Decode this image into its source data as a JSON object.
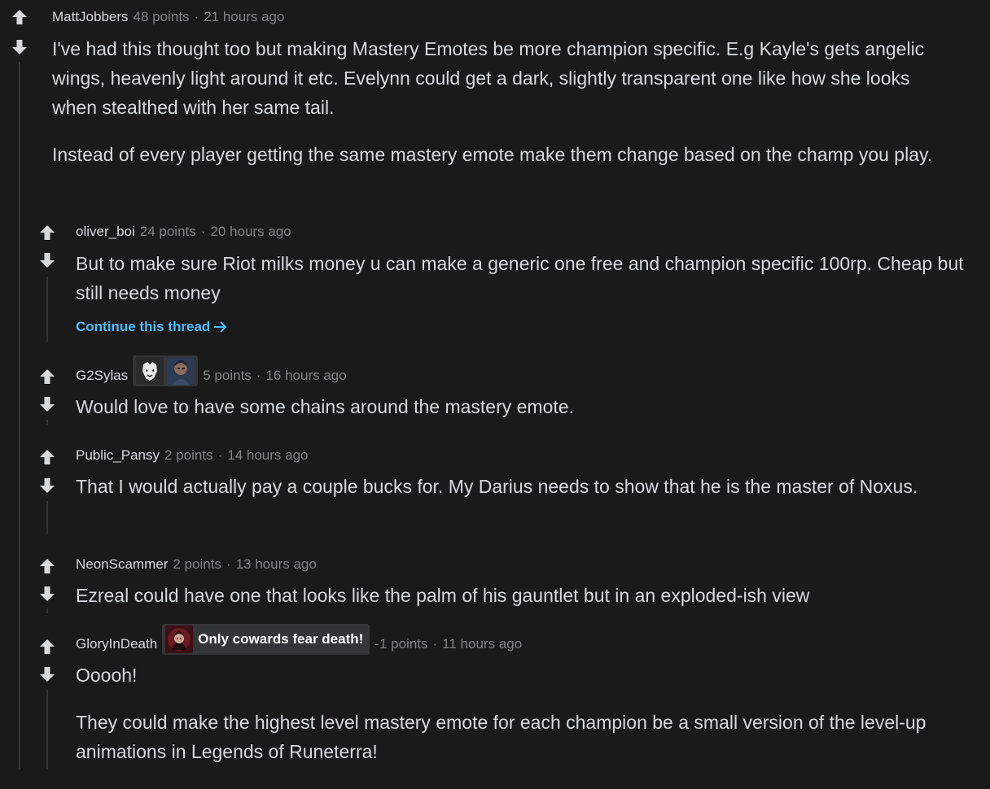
{
  "colors": {
    "background": "#1a1a1b",
    "text": "#d7dadc",
    "meta": "#818384",
    "arrow": "#d7dadc",
    "thread_line": "#343536",
    "link": "#4fbcff"
  },
  "icons": {
    "upvote": "arrow-up-icon",
    "downvote": "arrow-down-icon",
    "continue": "arrow-right-icon"
  },
  "comments": [
    {
      "author": "MattJobbers",
      "points": "48 points",
      "separator": "·",
      "time": "21 hours ago",
      "paragraphs": [
        "I've had this thought too but making Mastery Emotes be more champion specific. E.g Kayle's gets angelic wings, heavenly light around it etc. Evelynn could get a dark, slightly transparent one like how she looks when stealthed with her same tail.",
        "Instead of every player getting the same mastery emote make them change based on the champ you play."
      ]
    },
    {
      "author": "oliver_boi",
      "points": "24 points",
      "separator": "·",
      "time": "20 hours ago",
      "paragraphs": [
        "But to make sure Riot milks money u can make a generic one free and champion specific 100rp. Cheap but still needs money"
      ],
      "continue_label": "Continue this thread"
    },
    {
      "author": "G2Sylas",
      "flair_icons": [
        "g2-logo-icon",
        "sylas-portrait-icon"
      ],
      "points": "5 points",
      "separator": "·",
      "time": "16 hours ago",
      "paragraphs": [
        "Would love to have some chains around the mastery emote."
      ]
    },
    {
      "author": "Public_Pansy",
      "points": "2 points",
      "separator": "·",
      "time": "14 hours ago",
      "paragraphs": [
        "That I would actually pay a couple bucks for. My Darius needs to show that he is the master of Noxus."
      ]
    },
    {
      "author": "NeonScammer",
      "points": "2 points",
      "separator": "·",
      "time": "13 hours ago",
      "paragraphs": [
        "Ezreal could have one that looks like the palm of his gauntlet but in an exploded-ish view"
      ]
    },
    {
      "author": "GloryInDeath",
      "flair_icons": [
        "karthus-portrait-icon"
      ],
      "flair_text": "Only cowards fear death!",
      "points": "-1 points",
      "separator": "·",
      "time": "11 hours ago",
      "paragraphs": [
        "Ooooh!",
        "They could make the highest level mastery emote for each champion be a small version of the level-up animations in Legends of Runeterra!"
      ]
    }
  ]
}
